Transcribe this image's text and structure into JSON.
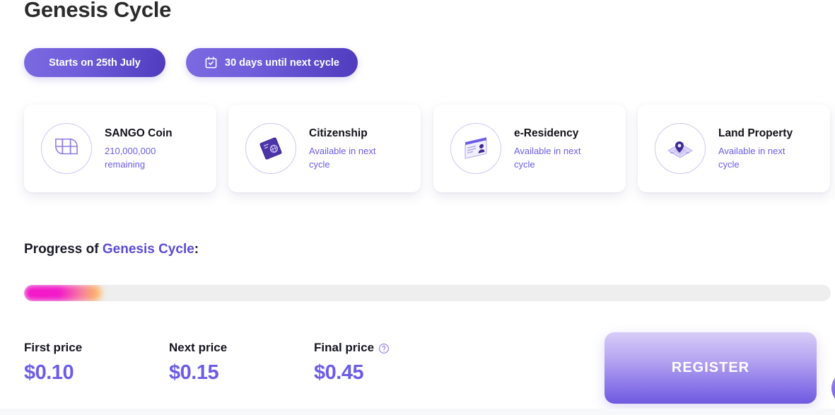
{
  "header": {
    "title": "Genesis Cycle"
  },
  "pills": [
    {
      "label": "Starts on 25th July",
      "icon": null
    },
    {
      "label": "30 days until next cycle",
      "icon": "calendar-check-icon"
    }
  ],
  "cards": [
    {
      "title": "SANGO Coin",
      "subtitle": "210,000,000 remaining",
      "icon": "sango-coin-logo-icon"
    },
    {
      "title": "Citizenship",
      "subtitle": "Available in next cycle",
      "icon": "passport-icon"
    },
    {
      "title": "e-Residency",
      "subtitle": "Available in next cycle",
      "icon": "id-card-icon"
    },
    {
      "title": "Land Property",
      "subtitle": "Available in next cycle",
      "icon": "land-map-pin-icon"
    }
  ],
  "progress": {
    "label_prefix": "Progress of ",
    "label_highlight": "Genesis Cycle",
    "label_suffix": ":",
    "percent": 9.7,
    "fill_start_color": "#f218c8",
    "fill_end_color": "#fbb36a",
    "track_color": "#eeeeee"
  },
  "prices": [
    {
      "label": "First price",
      "value": "$0.10",
      "help": false
    },
    {
      "label": "Next price",
      "value": "$0.15",
      "help": false
    },
    {
      "label": "Final price",
      "value": "$0.45",
      "help": true,
      "help_icon": "question-circle-icon"
    }
  ],
  "cta": {
    "register_label": "REGISTER"
  },
  "colors": {
    "accent_purple": "#6c5ce7",
    "deep_indigo": "#4f3bbd",
    "heading_dark": "#11111a",
    "card_border": "#cfc7f5"
  }
}
